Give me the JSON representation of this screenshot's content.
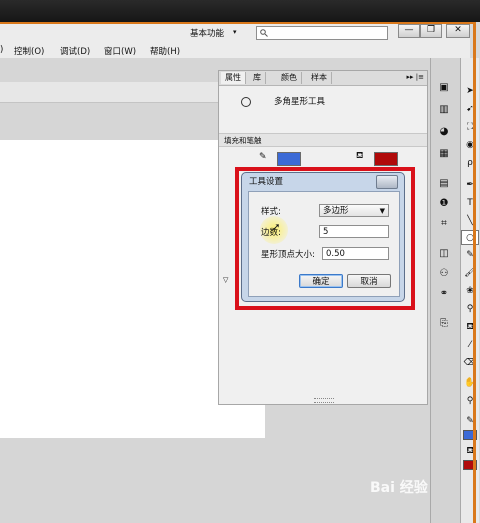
{
  "app": {
    "workspace_label": "基本功能",
    "window_buttons": [
      "—",
      "❐",
      "✕"
    ]
  },
  "menu": {
    "items": [
      "控制(O)",
      "调试(D)",
      "窗口(W)",
      "帮助(H)"
    ],
    "partial_first": ")"
  },
  "panel": {
    "tabs": [
      "属性",
      "库",
      "颜色",
      "样本"
    ],
    "menu_glyph": "▸▸ |≡",
    "tool_name": "多角星形工具",
    "section_fill_stroke": "填充和笔触",
    "stroke_color": "#3c6ad6",
    "fill_color": "#b00a0a",
    "section2_arrow": "▽"
  },
  "dialog": {
    "title": "工具设置",
    "style_label": "样式:",
    "style_value": "多边形",
    "sides_label": "边数:",
    "sides_value": "5",
    "star_label": "星形顶点大小:",
    "star_value": "0.50",
    "ok_label": "确定",
    "cancel_label": "取消"
  },
  "watermark": "Bai 经验",
  "colors": {
    "frame_accent": "#d9781b",
    "highlight": "#d9101a"
  }
}
